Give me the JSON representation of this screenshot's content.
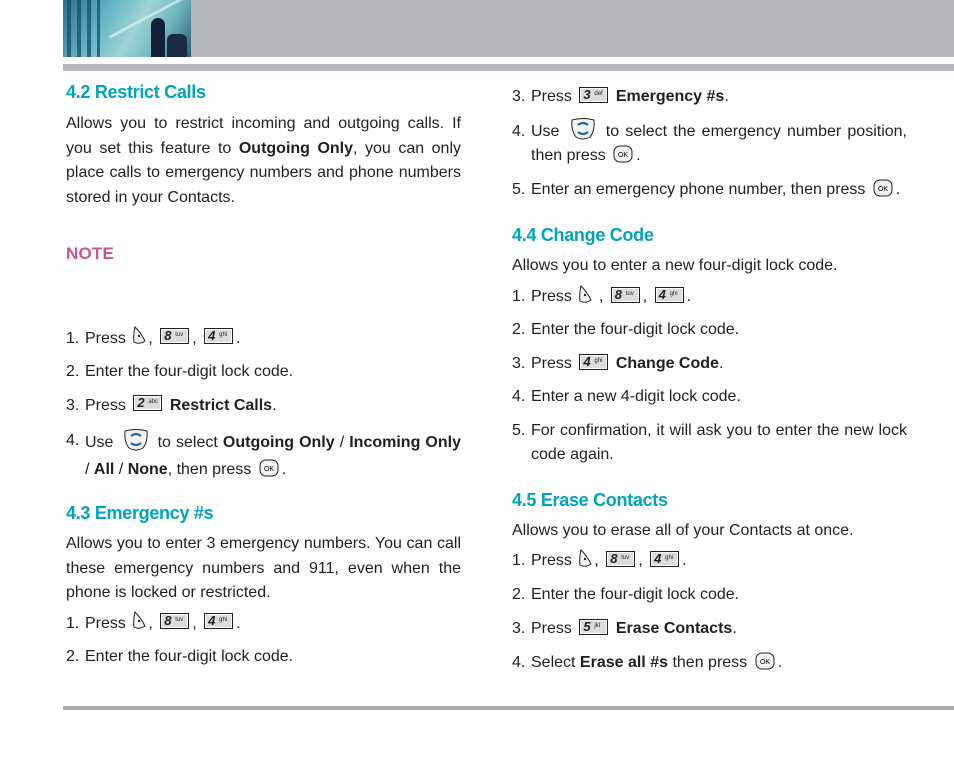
{
  "left": {
    "s42": {
      "title": "4.2 Restrict Calls",
      "desc_pre": "Allows you to restrict incoming and outgoing calls. If you set this feature to ",
      "desc_bold": "Outgoing Only",
      "desc_post": ", you can only place calls to emergency numbers and phone numbers stored in your Contacts.",
      "note": "NOTE",
      "steps": {
        "s1": {
          "num": "1.",
          "pre": "Press",
          "k1": {
            "digit": "8",
            "letters": "tuv"
          },
          "k2": {
            "digit": "4",
            "letters": "ghi"
          }
        },
        "s2": {
          "num": "2.",
          "text": "Enter the four-digit lock code."
        },
        "s3": {
          "num": "3.",
          "pre": "Press",
          "key": {
            "digit": "2",
            "letters": "abc"
          },
          "bold": "Restrict Calls",
          "post": "."
        },
        "s4": {
          "num": "4.",
          "pre": "Use",
          "mid": "to select",
          "b1": "Outgoing Only",
          "sep1": " / ",
          "b2": "Incoming Only",
          "sep2": " / ",
          "b3": "All",
          "sep3": " / ",
          "b4": "None",
          "post": ", then press"
        }
      }
    },
    "s43": {
      "title": "4.3 Emergency #s",
      "desc": "Allows you to enter 3 emergency numbers. You can call these emergency numbers and 911, even when the phone is locked or restricted.",
      "steps": {
        "s1": {
          "num": "1.",
          "pre": "Press",
          "k1": {
            "digit": "8",
            "letters": "tuv"
          },
          "k2": {
            "digit": "4",
            "letters": "ghi"
          }
        },
        "s2": {
          "num": "2.",
          "text": "Enter the four-digit lock code."
        }
      }
    }
  },
  "right": {
    "s43cont": {
      "s3": {
        "num": "3.",
        "pre": "Press",
        "key": {
          "digit": "3",
          "letters": "def"
        },
        "bold": "Emergency #s",
        "post": "."
      },
      "s4": {
        "num": "4.",
        "pre": "Use",
        "post": "to select the emergency number position, then press"
      },
      "s5": {
        "num": "5.",
        "text": "Enter an emergency phone number, then press"
      }
    },
    "s44": {
      "title": "4.4 Change Code",
      "desc": "Allows you to enter a new four-digit lock code.",
      "steps": {
        "s1": {
          "num": "1.",
          "pre": "Press",
          "k1": {
            "digit": "8",
            "letters": "tuv"
          },
          "k2": {
            "digit": "4",
            "letters": "ghi"
          }
        },
        "s2": {
          "num": "2.",
          "text": "Enter the four-digit lock code."
        },
        "s3": {
          "num": "3.",
          "pre": "Press",
          "key": {
            "digit": "4",
            "letters": "ghi"
          },
          "bold": "Change Code",
          "post": "."
        },
        "s4": {
          "num": "4.",
          "text": "Enter a new 4-digit lock code."
        },
        "s5": {
          "num": "5.",
          "text": "For confirmation, it will ask you to enter the new lock code again."
        }
      }
    },
    "s45": {
      "title": "4.5 Erase Contacts",
      "desc": "Allows you to erase all of your Contacts at once.",
      "steps": {
        "s1": {
          "num": "1.",
          "pre": "Press",
          "k1": {
            "digit": "8",
            "letters": "tuv"
          },
          "k2": {
            "digit": "4",
            "letters": "ghi"
          }
        },
        "s2": {
          "num": "2.",
          "text": "Enter the four-digit lock code."
        },
        "s3": {
          "num": "3.",
          "pre": "Press",
          "key": {
            "digit": "5",
            "letters": "jkl"
          },
          "bold": "Erase Contacts",
          "post": "."
        },
        "s4": {
          "num": "4.",
          "pre": "Select",
          "bold": "Erase all #s",
          "post": "then press"
        }
      }
    }
  },
  "punct": {
    "comma": ",",
    "period": "."
  },
  "icons": {
    "menu": "menu-key-icon",
    "nav": "navigation-key-icon",
    "ok": "ok-key-icon",
    "ok_label": "OK"
  },
  "colors": {
    "heading": "#00a4bd",
    "note": "#c8578a",
    "rule": "#b7b8bb"
  }
}
